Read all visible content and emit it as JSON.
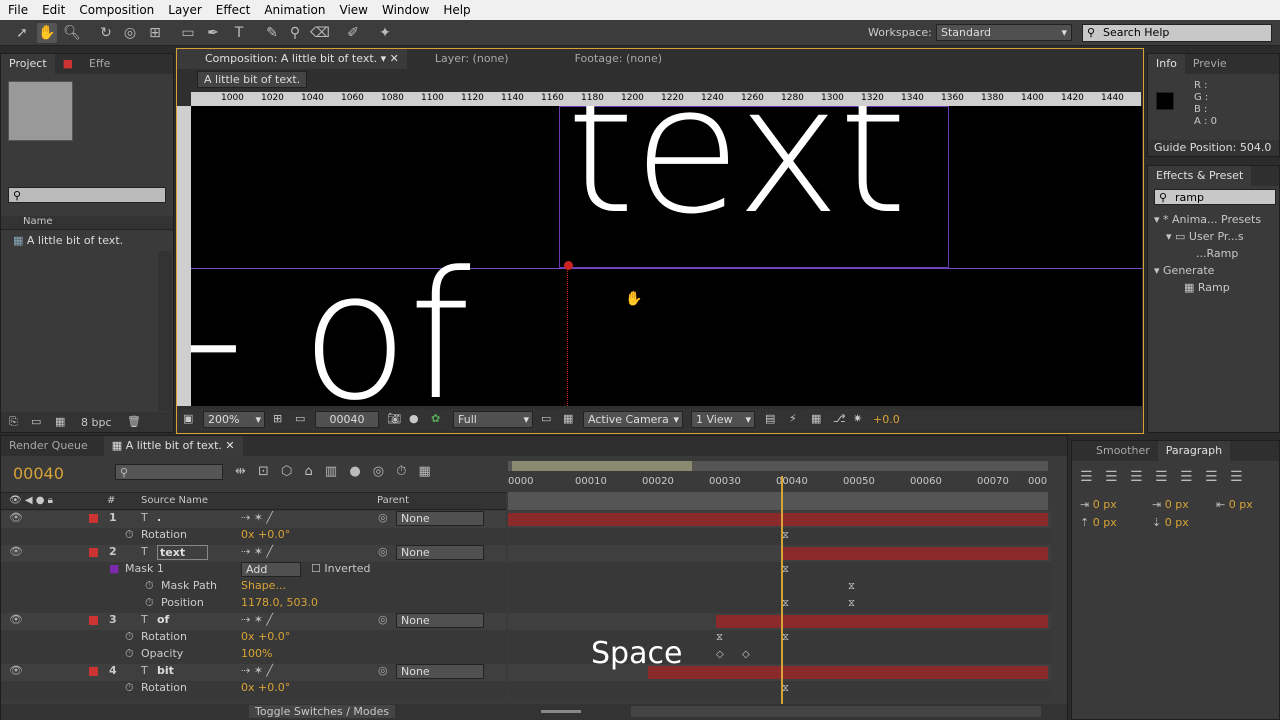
{
  "menu": [
    "File",
    "Edit",
    "Composition",
    "Layer",
    "Effect",
    "Animation",
    "View",
    "Window",
    "Help"
  ],
  "workspace": {
    "label": "Workspace:",
    "value": "Standard",
    "search_placeholder": "Search Help"
  },
  "project": {
    "tabs": [
      "Project",
      "Effe"
    ],
    "col_name": "Name",
    "item": "A little bit of text.",
    "bpc": "8 bpc"
  },
  "comp": {
    "tab": "Composition: A little bit of text.",
    "layer_tab": "Layer: (none)",
    "footage_tab": "Footage: (none)",
    "breadcrumb": "A little bit of text.",
    "ruler": [
      "1000",
      "1020",
      "1040",
      "1060",
      "1080",
      "1100",
      "1120",
      "1140",
      "1160",
      "1180",
      "1200",
      "1220",
      "1240",
      "1260",
      "1280",
      "1300",
      "1320",
      "1340",
      "1360",
      "1380",
      "1400",
      "1420",
      "1440",
      "14"
    ],
    "canvas_text_main": "text",
    "canvas_text_of": "of",
    "canvas_text_dash": "-",
    "zoom": "200%",
    "timecode": "00040",
    "quality": "Full",
    "camera": "Active Camera",
    "views": "1 View",
    "exposure": "+0.0"
  },
  "info": {
    "tabs": [
      "Info",
      "Previe"
    ],
    "r": "R :",
    "g": "G :",
    "b": "B :",
    "a": "A : 0",
    "guide": "Guide Position: 504.0"
  },
  "effects": {
    "tab": "Effects & Preset",
    "search": "ramp",
    "tree": [
      "* Anima... Presets",
      "User Pr...s",
      "...Ramp",
      "Generate",
      "Ramp"
    ]
  },
  "timeline": {
    "tabs": [
      "Render Queue",
      "A little bit of text."
    ],
    "timecode": "00040",
    "cols": {
      "num": "#",
      "source": "Source Name",
      "parent": "Parent"
    },
    "ticks": [
      "0000",
      "00010",
      "00020",
      "00030",
      "00040",
      "00050",
      "00060",
      "00070",
      "000"
    ],
    "rows": [
      {
        "num": "1",
        "name": ".",
        "type": "layer",
        "parent": "None"
      },
      {
        "name": "Rotation",
        "type": "prop",
        "value": "0x +0.0°"
      },
      {
        "num": "2",
        "name": "text",
        "type": "layer",
        "parent": "None"
      },
      {
        "name": "Mask 1",
        "type": "mask",
        "mode": "Add",
        "inverted": "Inverted"
      },
      {
        "name": "Mask Path",
        "type": "prop2",
        "value": "Shape..."
      },
      {
        "name": "Position",
        "type": "prop2",
        "value": "1178.0, 503.0"
      },
      {
        "num": "3",
        "name": "of",
        "type": "layer",
        "parent": "None"
      },
      {
        "name": "Rotation",
        "type": "prop",
        "value": "0x +0.0°"
      },
      {
        "name": "Opacity",
        "type": "prop",
        "value": "100%"
      },
      {
        "num": "4",
        "name": "bit",
        "type": "layer",
        "parent": "None"
      },
      {
        "name": "Rotation",
        "type": "prop",
        "value": "0x +0.0°"
      }
    ],
    "toggle": "Toggle Switches / Modes",
    "overlay_key": "Space"
  },
  "paragraph": {
    "tabs": [
      "Smoother",
      "Paragraph"
    ],
    "v1": "0 px",
    "v2": "0 px",
    "v3": "0 px",
    "v4": "0 px",
    "v5": "0 px"
  }
}
